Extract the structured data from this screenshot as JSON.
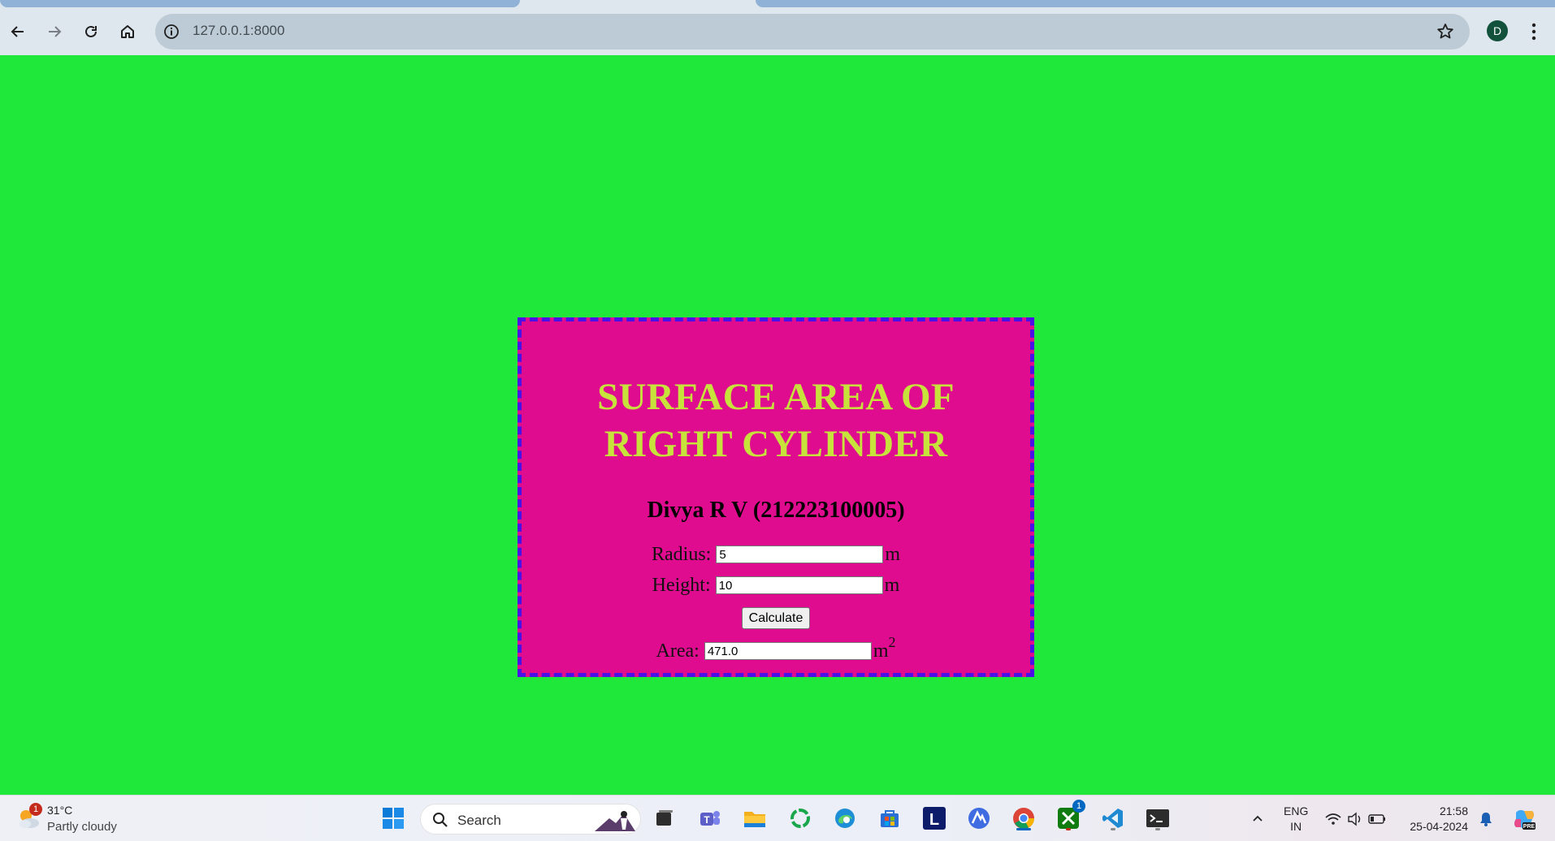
{
  "browser": {
    "url": "127.0.0.1:8000",
    "profile_initial": "D",
    "icons": {
      "back": "arrow-left-icon",
      "forward": "arrow-right-icon",
      "reload": "reload-icon",
      "home": "home-icon",
      "site_info": "info-icon",
      "bookmark": "star-icon",
      "menu": "kebab-menu-icon"
    }
  },
  "page": {
    "background_color": "#1fe83a",
    "card_color": "#df0c8f",
    "card_border_color": "#4a10e6",
    "title_color": "#c7e23b",
    "title_line1": "SURFACE AREA OF",
    "title_line2": "RIGHT CYLINDER",
    "author": "Divya R V (212223100005)",
    "radius": {
      "label": "Radius:",
      "value": "5",
      "unit": "m"
    },
    "height": {
      "label": "Height:",
      "value": "10",
      "unit": "m"
    },
    "calculate_label": "Calculate",
    "area": {
      "label": "Area:",
      "value": "471.0",
      "unit": "m",
      "unit_exp": "2"
    }
  },
  "taskbar": {
    "weather": {
      "badge": "1",
      "temp": "31°C",
      "desc": "Partly cloudy"
    },
    "search_label": "Search",
    "apps": [
      "windows-start-icon",
      "search-icon",
      "task-view-icon",
      "teams-icon",
      "file-explorer-icon",
      "refresh-app-icon",
      "edge-icon",
      "store-icon",
      "l-app-icon",
      "vpn-app-icon",
      "chrome-icon",
      "xbox-icon",
      "vscode-icon",
      "terminal-icon"
    ],
    "xbox_badge": "1",
    "lang_line1": "ENG",
    "lang_line2": "IN",
    "time": "21:58",
    "date": "25-04-2024"
  }
}
